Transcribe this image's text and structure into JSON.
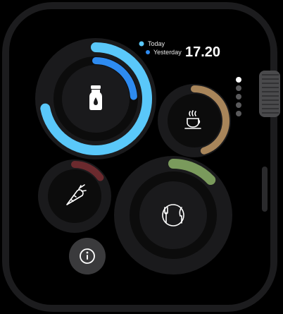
{
  "legend": {
    "today": {
      "label": "Today",
      "color": "#5AC8FA"
    },
    "yesterday": {
      "label": "Yesterday",
      "color": "#2E8BF0"
    }
  },
  "clock": {
    "time": "17.20"
  },
  "page_indicator": {
    "total": 5,
    "active": 1
  },
  "complications": [
    {
      "id": "water",
      "icon": "water-bottle-icon",
      "progress_today": 0.72,
      "progress_yesterday": 0.24,
      "color_today": "#5AC8FA",
      "color_yesterday": "#2E8BF0"
    },
    {
      "id": "coffee",
      "icon": "coffee-cup-icon",
      "progress": 0.45,
      "color": "#A8855A"
    },
    {
      "id": "vegetables",
      "icon": "carrot-icon",
      "progress": 0.15,
      "color": "#6B2A2E"
    },
    {
      "id": "meals",
      "icon": "fork-knife-icon",
      "progress": 0.13,
      "color": "#7A9A5C"
    }
  ],
  "info_button": {
    "icon": "info-icon"
  }
}
